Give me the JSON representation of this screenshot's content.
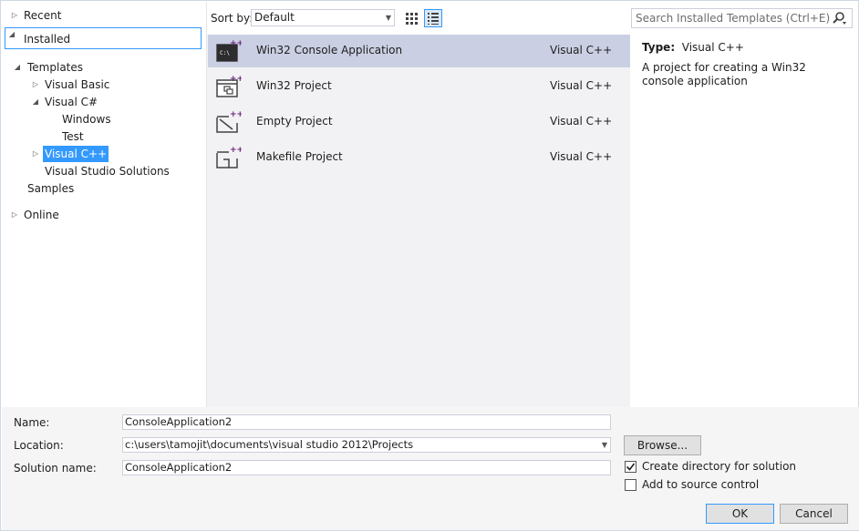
{
  "tree": {
    "recent": "Recent",
    "installed": "Installed",
    "templates": "Templates",
    "visual_basic": "Visual Basic",
    "visual_csharp": "Visual C#",
    "windows": "Windows",
    "test": "Test",
    "visual_cpp": "Visual C++",
    "vs_solutions": "Visual Studio Solutions",
    "samples": "Samples",
    "online": "Online"
  },
  "sort": {
    "label": "Sort by:",
    "value": "Default"
  },
  "templates": [
    {
      "name": "Win32 Console Application",
      "lang": "Visual C++"
    },
    {
      "name": "Win32 Project",
      "lang": "Visual C++"
    },
    {
      "name": "Empty Project",
      "lang": "Visual C++"
    },
    {
      "name": "Makefile Project",
      "lang": "Visual C++"
    }
  ],
  "search": {
    "placeholder": "Search Installed Templates (Ctrl+E)"
  },
  "details": {
    "type_label": "Type:",
    "type_value": "Visual C++",
    "description": "A project for creating a Win32 console application"
  },
  "form": {
    "name_label": "Name:",
    "name_value": "ConsoleApplication2",
    "location_label": "Location:",
    "location_value": "c:\\users\\tamojit\\documents\\visual studio 2012\\Projects",
    "solution_label": "Solution name:",
    "solution_value": "ConsoleApplication2",
    "browse_label": "Browse...",
    "create_dir_label": "Create directory for solution",
    "source_control_label": "Add to source control",
    "ok_label": "OK",
    "cancel_label": "Cancel"
  },
  "colors": {
    "accent": "#3399ff",
    "selected_row": "#cbcfe3",
    "icon_purple": "#68217a"
  }
}
